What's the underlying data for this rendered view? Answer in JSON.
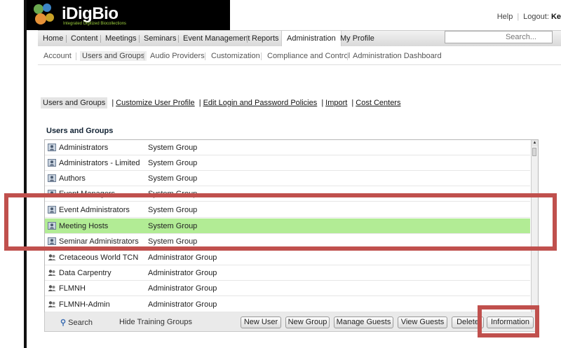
{
  "brand": {
    "name": "iDigBio",
    "tagline": "Integrated Digitized Biocollections"
  },
  "top_links": {
    "help": "Help",
    "logout": "Logout:",
    "user": "Ke"
  },
  "nav": {
    "items": [
      {
        "label": "Home"
      },
      {
        "label": "Content"
      },
      {
        "label": "Meetings"
      },
      {
        "label": "Seminars"
      },
      {
        "label": "Event Management"
      },
      {
        "label": "Reports"
      },
      {
        "label": "Administration"
      },
      {
        "label": "My Profile"
      }
    ],
    "active": "Administration"
  },
  "search": {
    "placeholder": "Search..."
  },
  "subnav": {
    "items": [
      {
        "label": "Account"
      },
      {
        "label": "Users and Groups"
      },
      {
        "label": "Audio Providers"
      },
      {
        "label": "Customization"
      },
      {
        "label": "Compliance and Control"
      },
      {
        "label": "Administration Dashboard"
      }
    ],
    "active": "Users and Groups"
  },
  "tabs": {
    "active": "Users and Groups",
    "links": [
      "Customize User Profile",
      "Edit Login and Password Policies",
      "Import",
      "Cost Centers"
    ]
  },
  "list": {
    "title": "Users and Groups",
    "rows": [
      {
        "name": "Administrators",
        "type": "System Group",
        "icon": "system-group-icon"
      },
      {
        "name": "Administrators - Limited",
        "type": "System Group",
        "icon": "system-group-icon"
      },
      {
        "name": "Authors",
        "type": "System Group",
        "icon": "system-group-icon"
      },
      {
        "name": "Event Managers",
        "type": "System Group",
        "icon": "system-group-icon"
      },
      {
        "name": "Event Administrators",
        "type": "System Group",
        "icon": "system-group-icon"
      },
      {
        "name": "Meeting Hosts",
        "type": "System Group",
        "icon": "system-group-icon",
        "selected": true
      },
      {
        "name": "Seminar Administrators",
        "type": "System Group",
        "icon": "system-group-icon"
      },
      {
        "name": "Cretaceous World TCN",
        "type": "Administrator Group",
        "icon": "admin-group-icon"
      },
      {
        "name": "Data Carpentry",
        "type": "Administrator Group",
        "icon": "admin-group-icon"
      },
      {
        "name": "FLMNH",
        "type": "Administrator Group",
        "icon": "admin-group-icon"
      },
      {
        "name": "FLMNH-Admin",
        "type": "Administrator Group",
        "icon": "admin-group-icon"
      }
    ]
  },
  "footer": {
    "search": "Search",
    "hide_training": "Hide Training Groups",
    "buttons": [
      "New User",
      "New Group",
      "Manage Guests",
      "View Guests",
      "Delete",
      "Information"
    ]
  },
  "colors": {
    "highlight": "#c0504d",
    "selected_row": "#b2ec95",
    "logo_bg": "#000000"
  }
}
